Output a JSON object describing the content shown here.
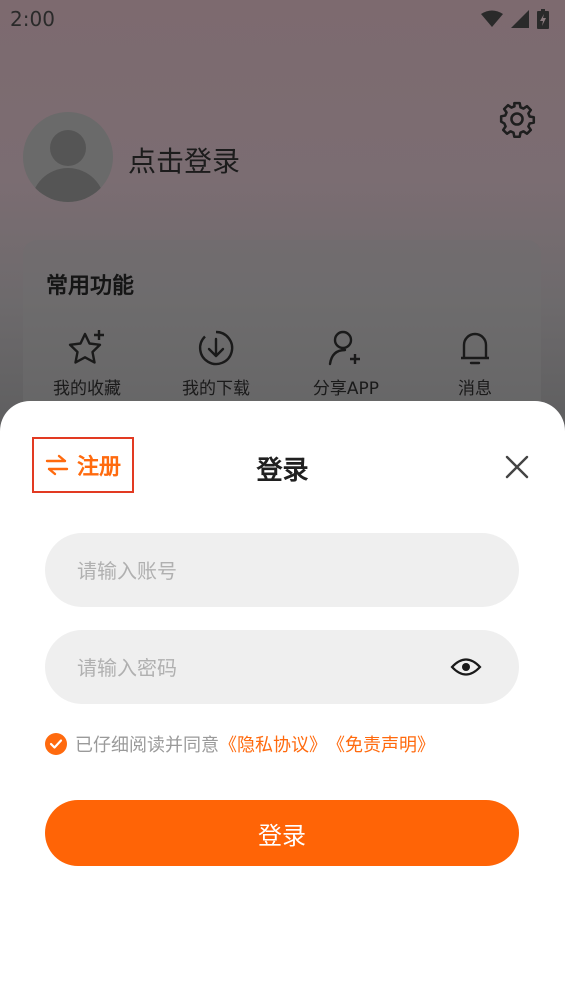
{
  "status_bar": {
    "time": "2:00"
  },
  "profile": {
    "login_prompt": "点击登录"
  },
  "common": {
    "title": "常用功能",
    "items": [
      {
        "label": "我的收藏",
        "icon": "star-add-icon"
      },
      {
        "label": "我的下载",
        "icon": "download-icon"
      },
      {
        "label": "分享APP",
        "icon": "user-add-icon"
      },
      {
        "label": "消息",
        "icon": "bell-icon"
      }
    ]
  },
  "login_sheet": {
    "register_label": "注册",
    "title": "登录",
    "account_placeholder": "请输入账号",
    "password_placeholder": "请输入密码",
    "agree_prefix": "已仔细阅读并同意",
    "privacy_link": "《隐私协议》",
    "disclaimer_link": "《免责声明》",
    "submit_label": "登录"
  },
  "colors": {
    "accent": "#ff6406",
    "highlight_border": "#e23a22"
  }
}
